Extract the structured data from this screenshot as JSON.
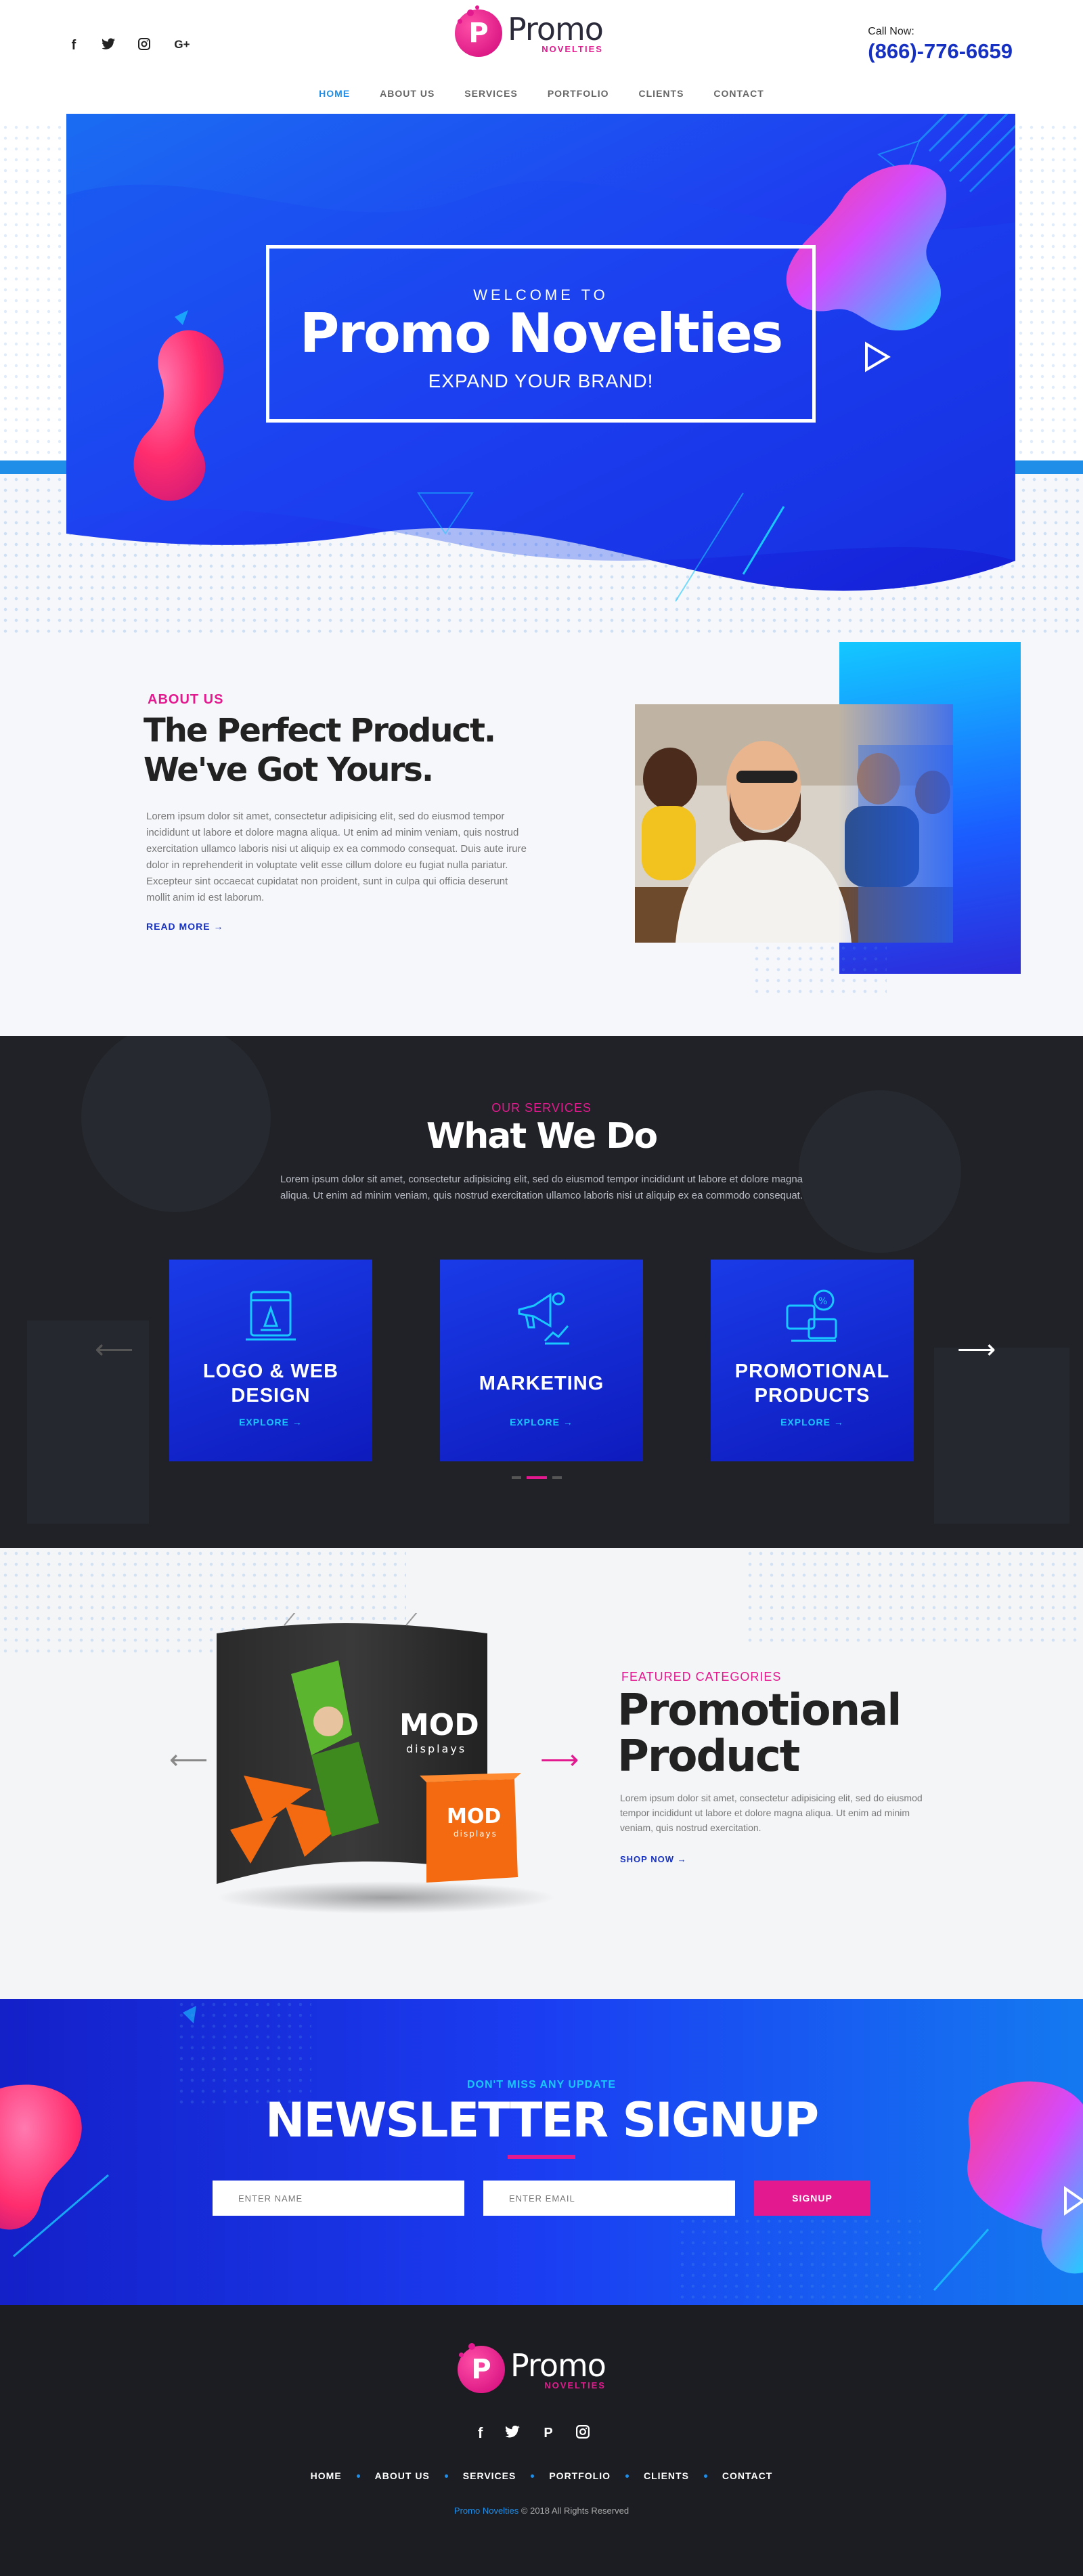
{
  "header": {
    "social": [
      {
        "icon": "facebook-icon",
        "glyph": "f"
      },
      {
        "icon": "twitter-icon",
        "glyph": "t"
      },
      {
        "icon": "instagram-icon",
        "glyph": "◎"
      },
      {
        "icon": "google-plus-icon",
        "glyph": "G+"
      }
    ],
    "logo": {
      "name": "Promo",
      "tagline": "NOVELTIES",
      "letter": "P"
    },
    "call_label": "Call Now:",
    "phone": "(866)-776-6659",
    "nav": [
      "HOME",
      "ABOUT US",
      "SERVICES",
      "PORTFOLIO",
      "CLIENTS",
      "CONTACT"
    ],
    "active_nav": "HOME"
  },
  "hero": {
    "welcome": "WELCOME TO",
    "title": "Promo Novelties",
    "subtitle": "EXPAND YOUR BRAND!"
  },
  "about": {
    "eyebrow": "ABOUT US",
    "heading_line1": "The Perfect Product.",
    "heading_line2": "We've Got Yours.",
    "body": "Lorem ipsum dolor sit amet, consectetur adipisicing elit, sed do eiusmod tempor incididunt ut labore et dolore magna aliqua. Ut enim ad minim veniam, quis nostrud exercitation ullamco laboris nisi ut aliquip ex ea commodo consequat. Duis aute irure dolor in reprehenderit in voluptate velit esse cillum dolore eu fugiat nulla pariatur. Excepteur sint occaecat cupidatat non proident, sunt in culpa qui officia deserunt mollit anim id est laborum.",
    "link": "READ MORE →"
  },
  "services": {
    "eyebrow": "OUR SERVICES",
    "heading": "What We Do",
    "body": "Lorem ipsum dolor sit amet, consectetur adipisicing elit, sed do eiusmod tempor incididunt ut labore et dolore magna aliqua. Ut enim ad minim veniam, quis nostrud exercitation ullamco laboris nisi ut aliquip ex ea commodo consequat.",
    "cards": [
      {
        "name": "LOGO & WEB DESIGN",
        "link": "EXPLORE →",
        "icon": "web-design-icon"
      },
      {
        "name": "MARKETING",
        "link": "EXPLORE →",
        "icon": "megaphone-icon"
      },
      {
        "name": "PROMOTIONAL PRODUCTS",
        "link": "EXPLORE →",
        "icon": "promo-products-icon"
      }
    ],
    "carousel_active_index": 1,
    "carousel_count": 3
  },
  "featured": {
    "eyebrow": "FEATURED CATEGORIES",
    "heading_line1": "Promotional",
    "heading_line2": "Product",
    "body": "Lorem ipsum dolor sit amet, consectetur adipisicing elit, sed do eiusmod tempor incididunt ut labore et dolore magna aliqua. Ut enim ad minim veniam, quis nostrud exercitation.",
    "link": "SHOP NOW →",
    "display_brand": "MOD",
    "display_sub": "displays"
  },
  "newsletter": {
    "eyebrow": "DON'T MISS ANY UPDATE",
    "heading": "NEWSLETTER SIGNUP",
    "name_placeholder": "ENTER NAME",
    "email_placeholder": "ENTER EMAIL",
    "button": "SIGNUP"
  },
  "footer": {
    "social": [
      {
        "icon": "facebook-icon",
        "glyph": "f"
      },
      {
        "icon": "twitter-icon",
        "glyph": "t"
      },
      {
        "icon": "pinterest-icon",
        "glyph": "P"
      },
      {
        "icon": "instagram-icon",
        "glyph": "◎"
      }
    ],
    "nav": [
      "HOME",
      "ABOUT US",
      "SERVICES",
      "PORTFOLIO",
      "CLIENTS",
      "CONTACT"
    ],
    "copyright_brand": "Promo Novelties",
    "copyright_rest": " © 2018 All Rights Reserved"
  },
  "colors": {
    "brand_blue": "#1631c2",
    "accent_pink": "#e31a8f",
    "nav_active": "#1f8ee8",
    "dark_bg": "#202227"
  }
}
